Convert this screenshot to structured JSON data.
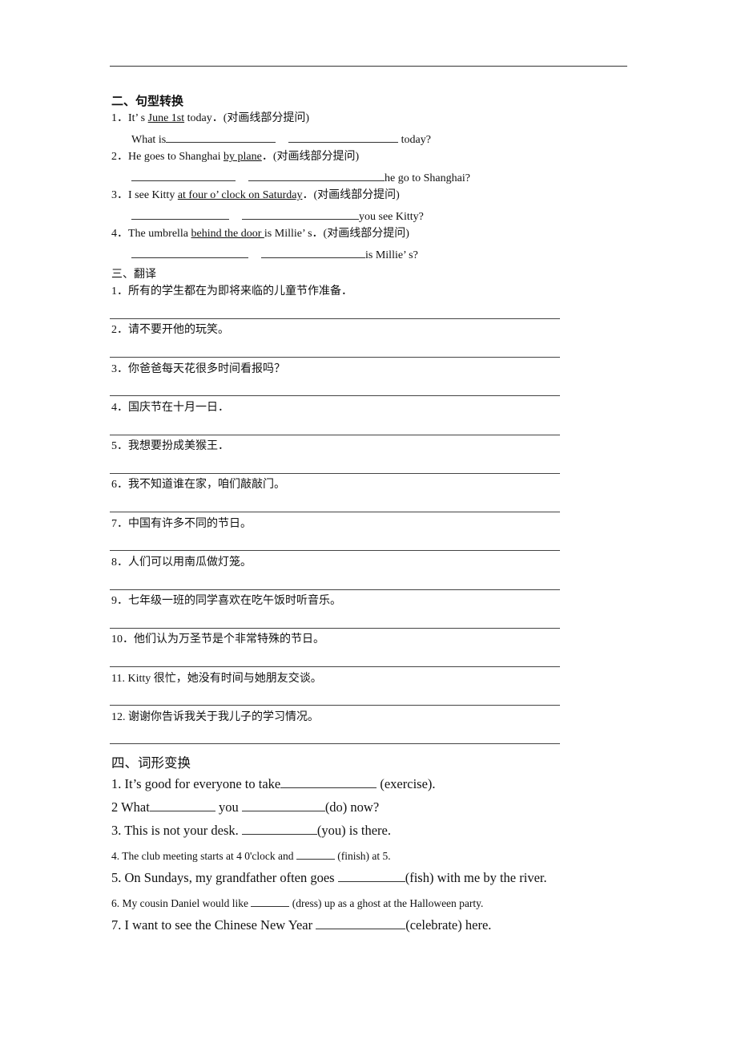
{
  "section2": {
    "title": "二、句型转换",
    "note": "(对画线部分提问)",
    "items": [
      {
        "num": "1．",
        "pre": "It’ s ",
        "underlined": "June 1st",
        "post": " today．",
        "answer_pre": "What is",
        "answer_post": " today?"
      },
      {
        "num": "2．",
        "pre": "He goes to Shanghai ",
        "underlined": "by plane",
        "post": "．",
        "answer_post": "he go to Shanghai?"
      },
      {
        "num": "3．",
        "pre": "I see Kitty ",
        "underlined": "at four o’ clock on Saturday",
        "post": "．",
        "answer_post": "you see Kitty?"
      },
      {
        "num": "4．",
        "pre": "The umbrella ",
        "underlined": "behind the door ",
        "post": "is Millie’ s．",
        "answer_post": "is Millie’ s?"
      }
    ]
  },
  "section3": {
    "title": "三、翻译",
    "items": [
      "1．所有的学生都在为即将来临的儿童节作准备．",
      "2．请不要开他的玩笑。",
      "3．你爸爸每天花很多时间看报吗？",
      "4．国庆节在十月一日．",
      "5．我想要扮成美猴王．",
      "6．我不知道谁在家，咱们敲敲门。",
      "7．中国有许多不同的节日。",
      "8．人们可以用南瓜做灯笼。",
      "9．七年级一班的同学喜欢在吃午饭时听音乐。",
      "10．他们认为万圣节是个非常特殊的节日。",
      "11. Kitty 很忙，她没有时间与她朋友交谈。",
      "12. 谢谢你告诉我关于我儿子的学习情况。"
    ]
  },
  "section4": {
    "title": "四、词形变换",
    "items": [
      {
        "a": "1. It’s good for everyone to take",
        "b": " (exercise)."
      },
      {
        "a": "2 What",
        "b": " you ",
        "c": "(do) now?"
      },
      {
        "a": "3. This is not your desk. ",
        "b": "(you) is there."
      },
      {
        "a": "4. The club meeting starts at 4 0'clock and ",
        "b": " (finish) at 5."
      },
      {
        "a": "5. On Sundays, my grandfather often goes ",
        "b": "(fish) with me by the river."
      },
      {
        "a": "6. My cousin Daniel would like ",
        "b": " (dress) up as a ghost at the Halloween party."
      },
      {
        "a": "7. I want to see the Chinese New Year ",
        "b": "(celebrate) here."
      }
    ]
  }
}
